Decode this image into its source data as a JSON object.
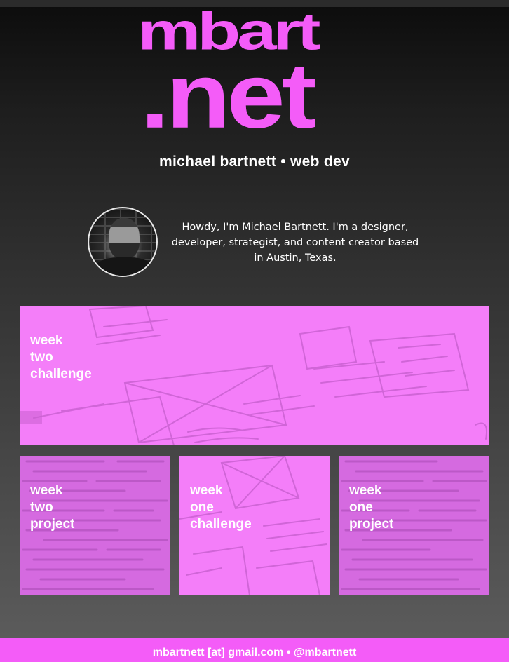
{
  "header": {
    "logo_line1": "mbart",
    "logo_line2": ".net",
    "tagline": "michael bartnett • web dev"
  },
  "intro": {
    "bio": "Howdy, I'm Michael Bartnett. I'm a designer, developer, strategist, and content creator based in Austin, Texas."
  },
  "tiles": [
    {
      "label": "week\ntwo\nchallenge",
      "style": "sketch"
    },
    {
      "label": "week\ntwo\nproject",
      "style": "code"
    },
    {
      "label": "week\none\nchallenge",
      "style": "sketch"
    },
    {
      "label": "week\none\nproject",
      "style": "code"
    }
  ],
  "footer": {
    "text": "mbartnett [at] gmail.com • @mbartnett"
  },
  "colors": {
    "accent": "#f45cf8",
    "tile_overlay": "#f47ef9"
  }
}
